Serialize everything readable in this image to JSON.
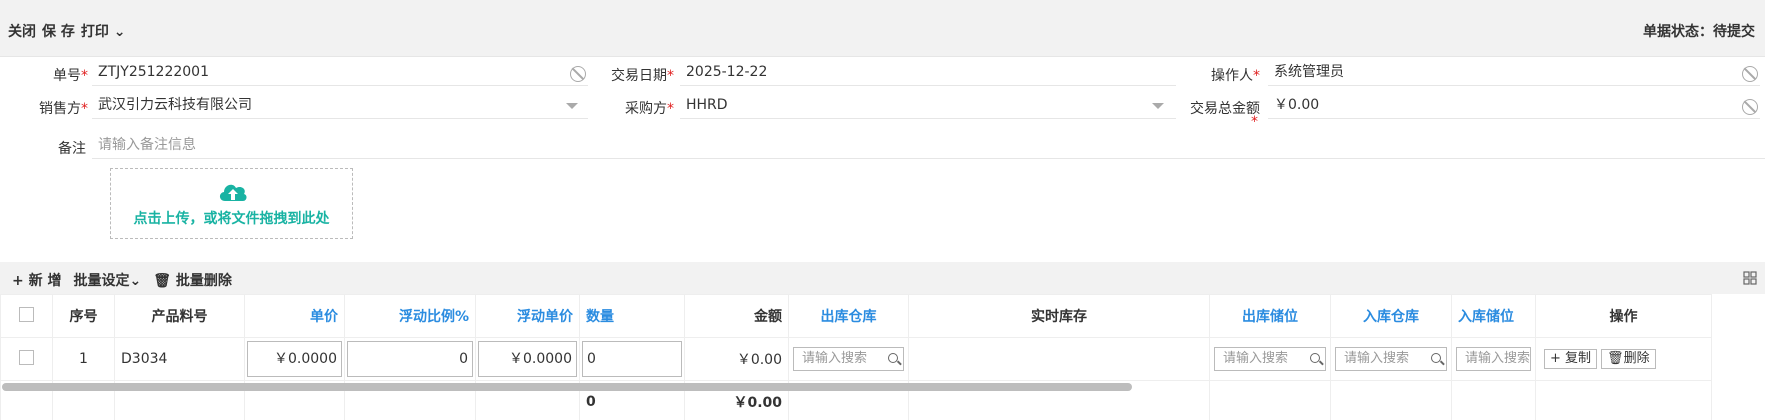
{
  "toolbar": {
    "close_label": "关闭",
    "save_label": "保 存",
    "print_label": "打印",
    "status_label": "单据状态：待提交"
  },
  "form": {
    "order_no": {
      "label": "单号",
      "required": true,
      "value": "ZTJY251222001"
    },
    "trade_date": {
      "label": "交易日期",
      "required": true,
      "value": "2025-12-22"
    },
    "operator": {
      "label": "操作人",
      "required": true,
      "value": "系统管理员"
    },
    "seller": {
      "label": "销售方",
      "required": true,
      "value": "武汉引力云科技有限公司"
    },
    "buyer": {
      "label": "采购方",
      "required": true,
      "value": "HHRD"
    },
    "total_amount": {
      "label": "交易总金额",
      "required": true,
      "value": "￥0.00"
    },
    "remark": {
      "label": "备注",
      "placeholder": "请输入备注信息"
    },
    "upload_text": "点击上传，或将文件拖拽到此处"
  },
  "grid_toolbar": {
    "add_label": "+ 新 增",
    "batch_set_label": "批量设定",
    "batch_delete_label": "批量删除"
  },
  "table": {
    "headers": {
      "index": "序号",
      "product_code": "产品料号",
      "unit_price": "单价",
      "float_ratio": "浮动比例%",
      "float_price": "浮动单价",
      "quantity": "数量",
      "amount": "金额",
      "out_warehouse": "出库仓库",
      "stock": "实时库存",
      "out_location": "出库储位",
      "in_warehouse": "入库仓库",
      "in_location": "入库储位",
      "actions": "操作"
    },
    "rows": [
      {
        "index": "1",
        "product_code": "D3034",
        "unit_price": "￥0.0000",
        "float_ratio": "0",
        "float_price": "￥0.0000",
        "quantity": "0",
        "amount": "￥0.00",
        "search_placeholder": "请输入搜索",
        "copy_label": "+ 复制",
        "delete_label": "删除"
      }
    ],
    "totals": {
      "quantity": "0",
      "amount": "￥0.00"
    }
  },
  "colors": {
    "accent": "#2b8ce0",
    "upload": "#19b3a3",
    "required": "#e02020"
  }
}
